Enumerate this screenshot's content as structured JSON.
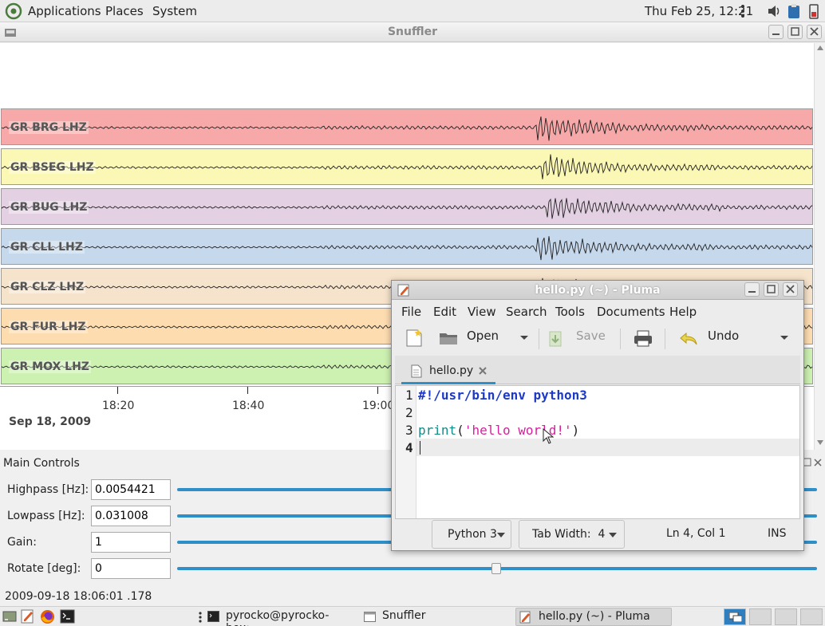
{
  "top_panel": {
    "menus": [
      "Applications",
      "Places",
      "System"
    ],
    "clock": "Thu Feb 25, 12:21"
  },
  "snuffler": {
    "title": "Snuffler",
    "traces": [
      {
        "label": "GR BRG LHZ",
        "color": "#f7a9a9"
      },
      {
        "label": "GR BSEG LHZ",
        "color": "#fbf7b4"
      },
      {
        "label": "GR BUG LHZ",
        "color": "#e3d1e3"
      },
      {
        "label": "GR CLL LHZ",
        "color": "#c6d8ec"
      },
      {
        "label": "GR CLZ LHZ",
        "color": "#f6e3cb"
      },
      {
        "label": "GR FUR LHZ",
        "color": "#fddcb0"
      },
      {
        "label": "GR MOX LHZ",
        "color": "#cdf1b1"
      }
    ],
    "time_ticks": [
      "18:20",
      "18:40",
      "19:00"
    ],
    "date": "Sep 18, 2009",
    "controls": {
      "title": "Main Controls",
      "highpass": {
        "label": "Highpass [Hz]:",
        "value": "0.0054421"
      },
      "lowpass": {
        "label": "Lowpass [Hz]:",
        "value": "0.031008"
      },
      "gain": {
        "label": "Gain:",
        "value": "1"
      },
      "rotate": {
        "label": "Rotate [deg]:",
        "value": "0"
      }
    },
    "time_readout": "2009-09-18 18:06:01 .178"
  },
  "pluma": {
    "title": "hello.py (~) - Pluma",
    "menus": [
      "File",
      "Edit",
      "View",
      "Search",
      "Tools",
      "Documents",
      "Help"
    ],
    "toolbar": {
      "open": "Open",
      "save": "Save",
      "undo": "Undo"
    },
    "tab": "hello.py",
    "lines": {
      "n1": "1",
      "n2": "2",
      "n3": "3",
      "n4": "4",
      "l1": "#!/usr/bin/env python3",
      "l3_func": "print",
      "l3_paren_open": "(",
      "l3_string": "'hello world!'",
      "l3_paren_close": ")"
    },
    "status": {
      "language": "Python 3",
      "tab_width": "Tab Width:  4",
      "position": "Ln 4, Col 1",
      "mode": "INS"
    }
  },
  "taskbar": {
    "tasks": [
      "pyrocko@pyrocko-box:...",
      "Snuffler",
      "hello.py (~) - Pluma"
    ]
  }
}
